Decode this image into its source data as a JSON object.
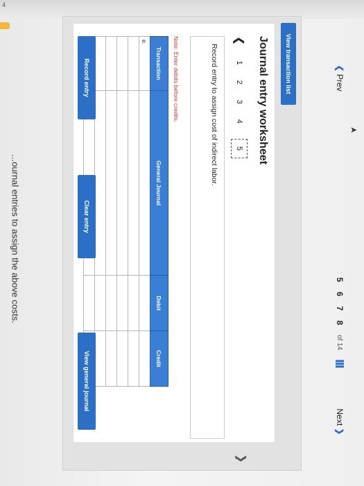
{
  "fragment_text": "...ournal entries to assign the above costs.",
  "corner_number": "4",
  "panel": {
    "view_transaction_list": "View transaction list",
    "title": "Journal entry worksheet",
    "steps": [
      "1",
      "2",
      "3",
      "4",
      "5"
    ],
    "description": "Record entry to assign cost of indirect labor.",
    "note": "Note: Enter debits before credits.",
    "table": {
      "headers": [
        "Transaction",
        "General Journal",
        "Debit",
        "Credit"
      ],
      "rows": [
        [
          "e.",
          "",
          "",
          ""
        ],
        [
          "",
          "",
          "",
          ""
        ],
        [
          "",
          "",
          "",
          ""
        ],
        [
          "",
          "",
          "",
          ""
        ],
        [
          "",
          "",
          "",
          ""
        ],
        [
          "",
          "",
          "",
          ""
        ]
      ]
    },
    "buttons": {
      "record": "Record entry",
      "clear": "Clear entry",
      "view_general": "View general journal"
    }
  },
  "pager": {
    "prev": "Prev",
    "pages": [
      "5",
      "6",
      "7",
      "8"
    ],
    "of": "of 14",
    "next": "Next"
  }
}
